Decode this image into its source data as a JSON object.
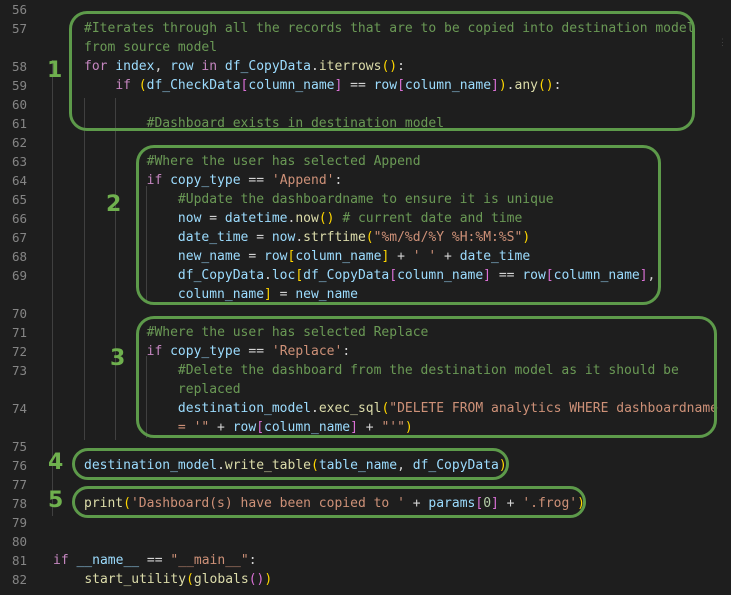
{
  "colors": {
    "background": "#1e1e1e",
    "line_number": "#858585",
    "box_outline": "#5d9a4a",
    "annotation_number": "#6fb04e"
  },
  "annotations": [
    "1",
    "2",
    "3",
    "4",
    "5"
  ],
  "lines": [
    {
      "n": "56",
      "tokens": []
    },
    {
      "n": "57",
      "tokens": [
        [
          "comment",
          "#Iterates through all the records that are to be copied into destination model"
        ]
      ]
    },
    {
      "n": "",
      "tokens": [
        [
          "comment",
          "from source model"
        ]
      ]
    },
    {
      "n": "58",
      "tokens": [
        [
          "kw",
          "for"
        ],
        [
          "op",
          " "
        ],
        [
          "var",
          "index"
        ],
        [
          "op",
          ", "
        ],
        [
          "var",
          "row"
        ],
        [
          "op",
          " "
        ],
        [
          "kw",
          "in"
        ],
        [
          "op",
          " "
        ],
        [
          "var",
          "df_CopyData"
        ],
        [
          "op",
          "."
        ],
        [
          "fn",
          "iterrows"
        ],
        [
          "bracket",
          "()"
        ],
        [
          "op",
          ":"
        ]
      ]
    },
    {
      "n": "59",
      "tokens": [
        [
          "op",
          "    "
        ],
        [
          "kw",
          "if"
        ],
        [
          "op",
          " "
        ],
        [
          "bracket",
          "("
        ],
        [
          "var",
          "df_CheckData"
        ],
        [
          "bracket2",
          "["
        ],
        [
          "var",
          "column_name"
        ],
        [
          "bracket2",
          "]"
        ],
        [
          "op",
          " == "
        ],
        [
          "var",
          "row"
        ],
        [
          "bracket2",
          "["
        ],
        [
          "var",
          "column_name"
        ],
        [
          "bracket2",
          "]"
        ],
        [
          "bracket",
          ")"
        ],
        [
          "op",
          "."
        ],
        [
          "fn",
          "any"
        ],
        [
          "bracket",
          "()"
        ],
        [
          "op",
          ":"
        ]
      ]
    },
    {
      "n": "60",
      "tokens": []
    },
    {
      "n": "61",
      "tokens": [
        [
          "op",
          "        "
        ],
        [
          "comment",
          "#Dashboard exists in destination model"
        ]
      ]
    },
    {
      "n": "62",
      "tokens": []
    },
    {
      "n": "63",
      "tokens": [
        [
          "op",
          "        "
        ],
        [
          "comment",
          "#Where the user has selected Append"
        ]
      ]
    },
    {
      "n": "64",
      "tokens": [
        [
          "op",
          "        "
        ],
        [
          "kw",
          "if"
        ],
        [
          "op",
          " "
        ],
        [
          "var",
          "copy_type"
        ],
        [
          "op",
          " == "
        ],
        [
          "str",
          "'Append'"
        ],
        [
          "op",
          ":"
        ]
      ]
    },
    {
      "n": "65",
      "tokens": [
        [
          "op",
          "            "
        ],
        [
          "comment",
          "#Update the dashboardname to ensure it is unique"
        ]
      ]
    },
    {
      "n": "66",
      "tokens": [
        [
          "op",
          "            "
        ],
        [
          "var",
          "now"
        ],
        [
          "op",
          " = "
        ],
        [
          "var",
          "datetime"
        ],
        [
          "op",
          "."
        ],
        [
          "fn",
          "now"
        ],
        [
          "bracket",
          "()"
        ],
        [
          "op",
          " "
        ],
        [
          "comment",
          "# current date and time"
        ]
      ]
    },
    {
      "n": "67",
      "tokens": [
        [
          "op",
          "            "
        ],
        [
          "var",
          "date_time"
        ],
        [
          "op",
          " = "
        ],
        [
          "var",
          "now"
        ],
        [
          "op",
          "."
        ],
        [
          "fn",
          "strftime"
        ],
        [
          "bracket",
          "("
        ],
        [
          "str",
          "\"%m/%d/%Y %H:%M:%S\""
        ],
        [
          "bracket",
          ")"
        ]
      ]
    },
    {
      "n": "68",
      "tokens": [
        [
          "op",
          "            "
        ],
        [
          "var",
          "new_name"
        ],
        [
          "op",
          " = "
        ],
        [
          "var",
          "row"
        ],
        [
          "bracket",
          "["
        ],
        [
          "var",
          "column_name"
        ],
        [
          "bracket",
          "]"
        ],
        [
          "op",
          " + "
        ],
        [
          "str",
          "' '"
        ],
        [
          "op",
          " + "
        ],
        [
          "var",
          "date_time"
        ]
      ]
    },
    {
      "n": "69",
      "tokens": [
        [
          "op",
          "            "
        ],
        [
          "var",
          "df_CopyData"
        ],
        [
          "op",
          "."
        ],
        [
          "var",
          "loc"
        ],
        [
          "bracket",
          "["
        ],
        [
          "var",
          "df_CopyData"
        ],
        [
          "bracket2",
          "["
        ],
        [
          "var",
          "column_name"
        ],
        [
          "bracket2",
          "]"
        ],
        [
          "op",
          " == "
        ],
        [
          "var",
          "row"
        ],
        [
          "bracket2",
          "["
        ],
        [
          "var",
          "column_name"
        ],
        [
          "bracket2",
          "]"
        ],
        [
          "op",
          ","
        ]
      ]
    },
    {
      "n": "",
      "tokens": [
        [
          "op",
          "            "
        ],
        [
          "var",
          "column_name"
        ],
        [
          "bracket",
          "]"
        ],
        [
          "op",
          " = "
        ],
        [
          "var",
          "new_name"
        ]
      ]
    },
    {
      "n": "70",
      "tokens": []
    },
    {
      "n": "71",
      "tokens": [
        [
          "op",
          "        "
        ],
        [
          "comment",
          "#Where the user has selected Replace"
        ]
      ]
    },
    {
      "n": "72",
      "tokens": [
        [
          "op",
          "        "
        ],
        [
          "kw",
          "if"
        ],
        [
          "op",
          " "
        ],
        [
          "var",
          "copy_type"
        ],
        [
          "op",
          " == "
        ],
        [
          "str",
          "'Replace'"
        ],
        [
          "op",
          ":"
        ]
      ]
    },
    {
      "n": "73",
      "tokens": [
        [
          "op",
          "            "
        ],
        [
          "comment",
          "#Delete the dashboard from the destination model as it should be"
        ]
      ]
    },
    {
      "n": "",
      "tokens": [
        [
          "op",
          "            "
        ],
        [
          "comment",
          "replaced"
        ]
      ]
    },
    {
      "n": "74",
      "tokens": [
        [
          "op",
          "            "
        ],
        [
          "var",
          "destination_model"
        ],
        [
          "op",
          "."
        ],
        [
          "fn",
          "exec_sql"
        ],
        [
          "bracket",
          "("
        ],
        [
          "str",
          "\"DELETE FROM analytics WHERE dashboardname"
        ]
      ]
    },
    {
      "n": "",
      "tokens": [
        [
          "op",
          "            "
        ],
        [
          "str",
          "= '\""
        ],
        [
          "op",
          " + "
        ],
        [
          "var",
          "row"
        ],
        [
          "bracket2",
          "["
        ],
        [
          "var",
          "column_name"
        ],
        [
          "bracket2",
          "]"
        ],
        [
          "op",
          " + "
        ],
        [
          "str",
          "\"'\""
        ],
        [
          "bracket",
          ")"
        ]
      ]
    },
    {
      "n": "75",
      "tokens": []
    },
    {
      "n": "76",
      "tokens": [
        [
          "var",
          "destination_model"
        ],
        [
          "op",
          "."
        ],
        [
          "fn",
          "write_table"
        ],
        [
          "bracket",
          "("
        ],
        [
          "var",
          "table_name"
        ],
        [
          "op",
          ", "
        ],
        [
          "var",
          "df_CopyData"
        ],
        [
          "bracket",
          ")"
        ]
      ]
    },
    {
      "n": "77",
      "tokens": []
    },
    {
      "n": "78",
      "tokens": [
        [
          "fn",
          "print"
        ],
        [
          "bracket",
          "("
        ],
        [
          "str",
          "'Dashboard(s) have been copied to '"
        ],
        [
          "op",
          " + "
        ],
        [
          "var",
          "params"
        ],
        [
          "bracket2",
          "["
        ],
        [
          "num",
          "0"
        ],
        [
          "bracket2",
          "]"
        ],
        [
          "op",
          " + "
        ],
        [
          "str",
          "'.frog'"
        ],
        [
          "bracket",
          ")"
        ]
      ]
    },
    {
      "n": "79",
      "tokens": []
    },
    {
      "n": "80",
      "tokens": []
    },
    {
      "n": "81",
      "tokens": [
        [
          "kw",
          "if"
        ],
        [
          "op",
          " "
        ],
        [
          "var",
          "__name__"
        ],
        [
          "op",
          " == "
        ],
        [
          "str",
          "\"__main__\""
        ],
        [
          "op",
          ":"
        ]
      ]
    },
    {
      "n": "82",
      "tokens": [
        [
          "op",
          "    "
        ],
        [
          "fn",
          "start_utility"
        ],
        [
          "bracket",
          "("
        ],
        [
          "fn",
          "globals"
        ],
        [
          "bracket2",
          "()"
        ],
        [
          "bracket",
          ")"
        ]
      ]
    }
  ]
}
